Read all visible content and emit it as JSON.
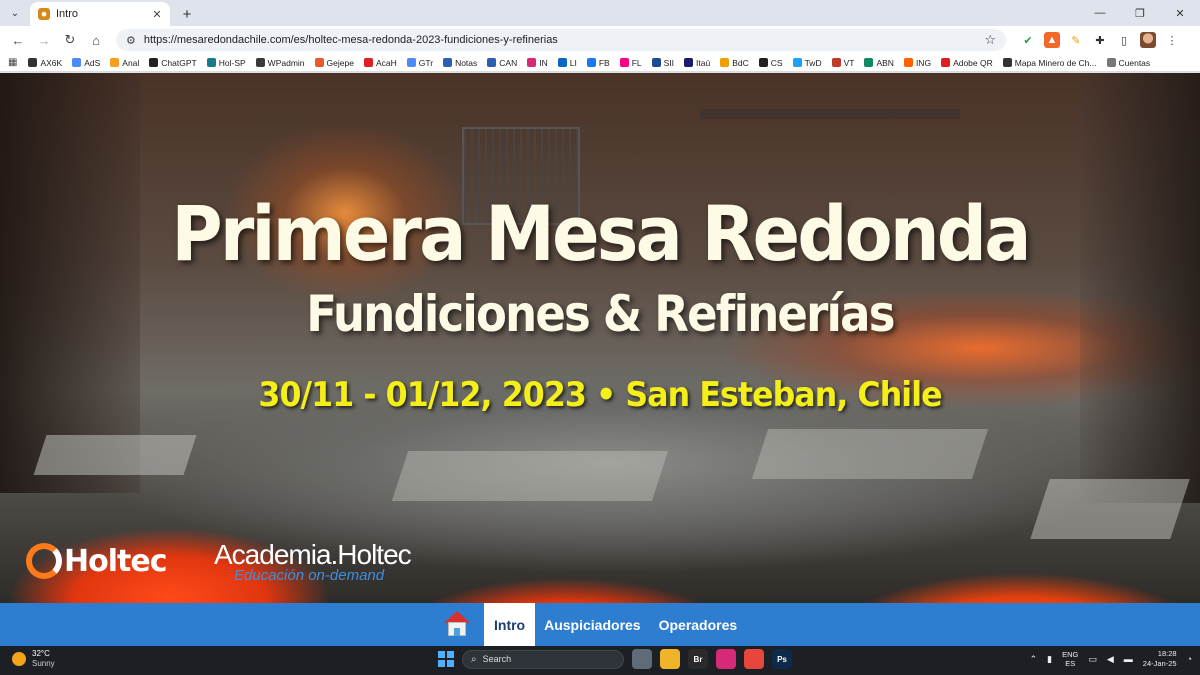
{
  "browser": {
    "tab_title": "Intro",
    "url": "https://mesaredondachile.com/es/holtec-mesa-redonda-2023-fundiciones-y-refinerias",
    "bookmarks": [
      {
        "label": "AX6K",
        "color": "#333333"
      },
      {
        "label": "AdS",
        "color": "#4c8bf5"
      },
      {
        "label": "Anal",
        "color": "#f4a020"
      },
      {
        "label": "ChatGPT",
        "color": "#222222"
      },
      {
        "label": "Hol-SP",
        "color": "#1b7a8a"
      },
      {
        "label": "WPadmin",
        "color": "#3a3a3a"
      },
      {
        "label": "Gejepe",
        "color": "#e85a2a"
      },
      {
        "label": "AcaH",
        "color": "#e02020"
      },
      {
        "label": "GTr",
        "color": "#4c8bf5"
      },
      {
        "label": "Notas",
        "color": "#2b5fb0"
      },
      {
        "label": "CAN",
        "color": "#2b5fb0"
      },
      {
        "label": "IN",
        "color": "#d62976"
      },
      {
        "label": "LI",
        "color": "#0a66c2"
      },
      {
        "label": "FB",
        "color": "#1877f2"
      },
      {
        "label": "FL",
        "color": "#ff0084"
      },
      {
        "label": "SII",
        "color": "#1a4d8f"
      },
      {
        "label": "Itaú",
        "color": "#1a1a6e"
      },
      {
        "label": "BdC",
        "color": "#f0a000"
      },
      {
        "label": "CS",
        "color": "#222222"
      },
      {
        "label": "TwD",
        "color": "#1da1f2"
      },
      {
        "label": "VT",
        "color": "#c0392b"
      },
      {
        "label": "ABN",
        "color": "#0f8a5f"
      },
      {
        "label": "ING",
        "color": "#ff6200"
      },
      {
        "label": "Adobe QR",
        "color": "#e02020"
      },
      {
        "label": "Mapa Minero de Ch...",
        "color": "#333333"
      },
      {
        "label": "Cuentas",
        "color": "#777777"
      }
    ]
  },
  "hero": {
    "title": "Primera Mesa Redonda",
    "subtitle": "Fundiciones & Refinerías",
    "date_location": "30/11 - 01/12, 2023 • San Esteban, Chile",
    "logo_holtec": "Holtec",
    "logo_academia": "Academia.Holtec",
    "logo_academia_tagline": "Educación on-demand"
  },
  "nav": {
    "items": [
      {
        "label": "Intro",
        "active": true
      },
      {
        "label": "Auspiciadores",
        "active": false
      },
      {
        "label": "Operadores",
        "active": false
      }
    ]
  },
  "taskbar": {
    "weather_temp": "32°C",
    "weather_desc": "Sunny",
    "search_placeholder": "Search",
    "apps": [
      {
        "label": "",
        "color": "#5f6b78",
        "name": "task-view-icon"
      },
      {
        "label": "",
        "color": "#f0b429",
        "name": "file-explorer-icon"
      },
      {
        "label": "Br",
        "color": "#2a2a2a",
        "name": "bridge-icon"
      },
      {
        "label": "",
        "color": "#d62976",
        "name": "instagram-icon"
      },
      {
        "label": "",
        "color": "#e8453c",
        "name": "chrome-icon"
      },
      {
        "label": "Ps",
        "color": "#0d2a4a",
        "name": "photoshop-icon"
      }
    ],
    "lang_1": "ENG",
    "lang_2": "ES",
    "time": "18:28",
    "date": "24-Jan-25"
  }
}
